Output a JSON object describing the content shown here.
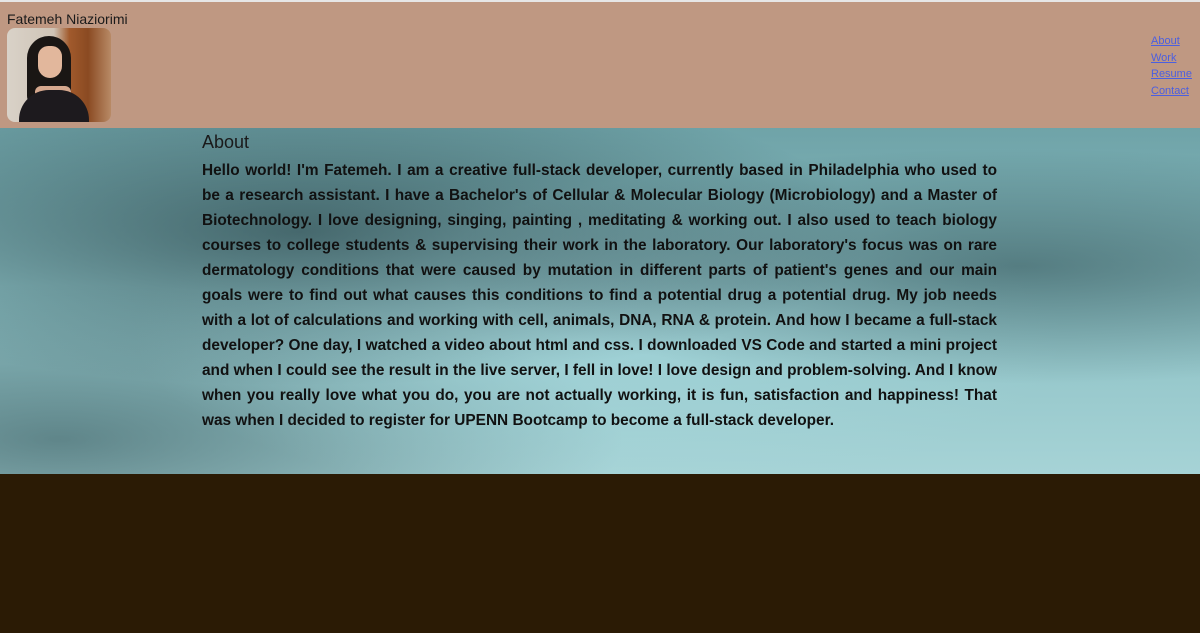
{
  "header": {
    "name": "Fatemeh Niaziorimi",
    "nav": [
      "About",
      "Work",
      "Resume",
      "Contact"
    ]
  },
  "about": {
    "heading": "About",
    "text": "Hello world! I'm Fatemeh. I am a creative full-stack developer, currently based in Philadelphia who used to be a research assistant. I have a Bachelor's of Cellular & Molecular Biology (Microbiology) and a Master of Biotechnology. I love designing, singing, painting , meditating & working out. I also used to teach biology courses to college students & supervising their work in the laboratory. Our laboratory's focus was on rare dermatology conditions that were caused by mutation in different parts of patient's genes and our main goals were to find out what causes this conditions to find a potential drug a potential drug. My job needs with a lot of calculations and working with cell, animals, DNA, RNA & protein. And how I became a full-stack developer? One day, I watched a video about html and css. I downloaded VS Code and started a mini project and when I could see the result in the live server, I fell in love! I love design and problem-solving. And I know when you really love what you do, you are not actually working, it is fun, satisfaction and happiness! That was when I decided to register for UPENN Bootcamp to become a full-stack developer."
  },
  "colors": {
    "header_bg": "#bf9882",
    "footer_bg": "#2b1b05",
    "link": "#4b5fe0"
  }
}
